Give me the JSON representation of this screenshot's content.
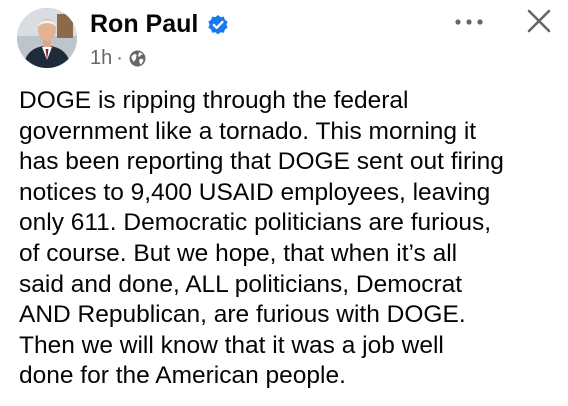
{
  "post": {
    "author": "Ron Paul",
    "verified_icon": "verified-badge-icon",
    "timestamp": "1h",
    "separator": "·",
    "audience_icon": "globe-icon",
    "more_icon": "more-options-icon",
    "close_icon": "close-icon",
    "text": "DOGE is ripping through the federal\ngovernment like a tornado. This morning it\nhas been reporting that DOGE sent out firing\nnotices to 9,400 USAID employees, leaving\nonly 611. Democratic politicians are furious,\nof course. But we hope, that when it’s all\nsaid and done, ALL politicians, Democrat\nAND Republican, are furious with DOGE.\nThen we will know that it was a job well\ndone for the American people."
  },
  "colors": {
    "verified_blue": "#1877f2",
    "secondary_text": "#65676b",
    "icon_gray": "#65676b",
    "text": "#050505"
  }
}
